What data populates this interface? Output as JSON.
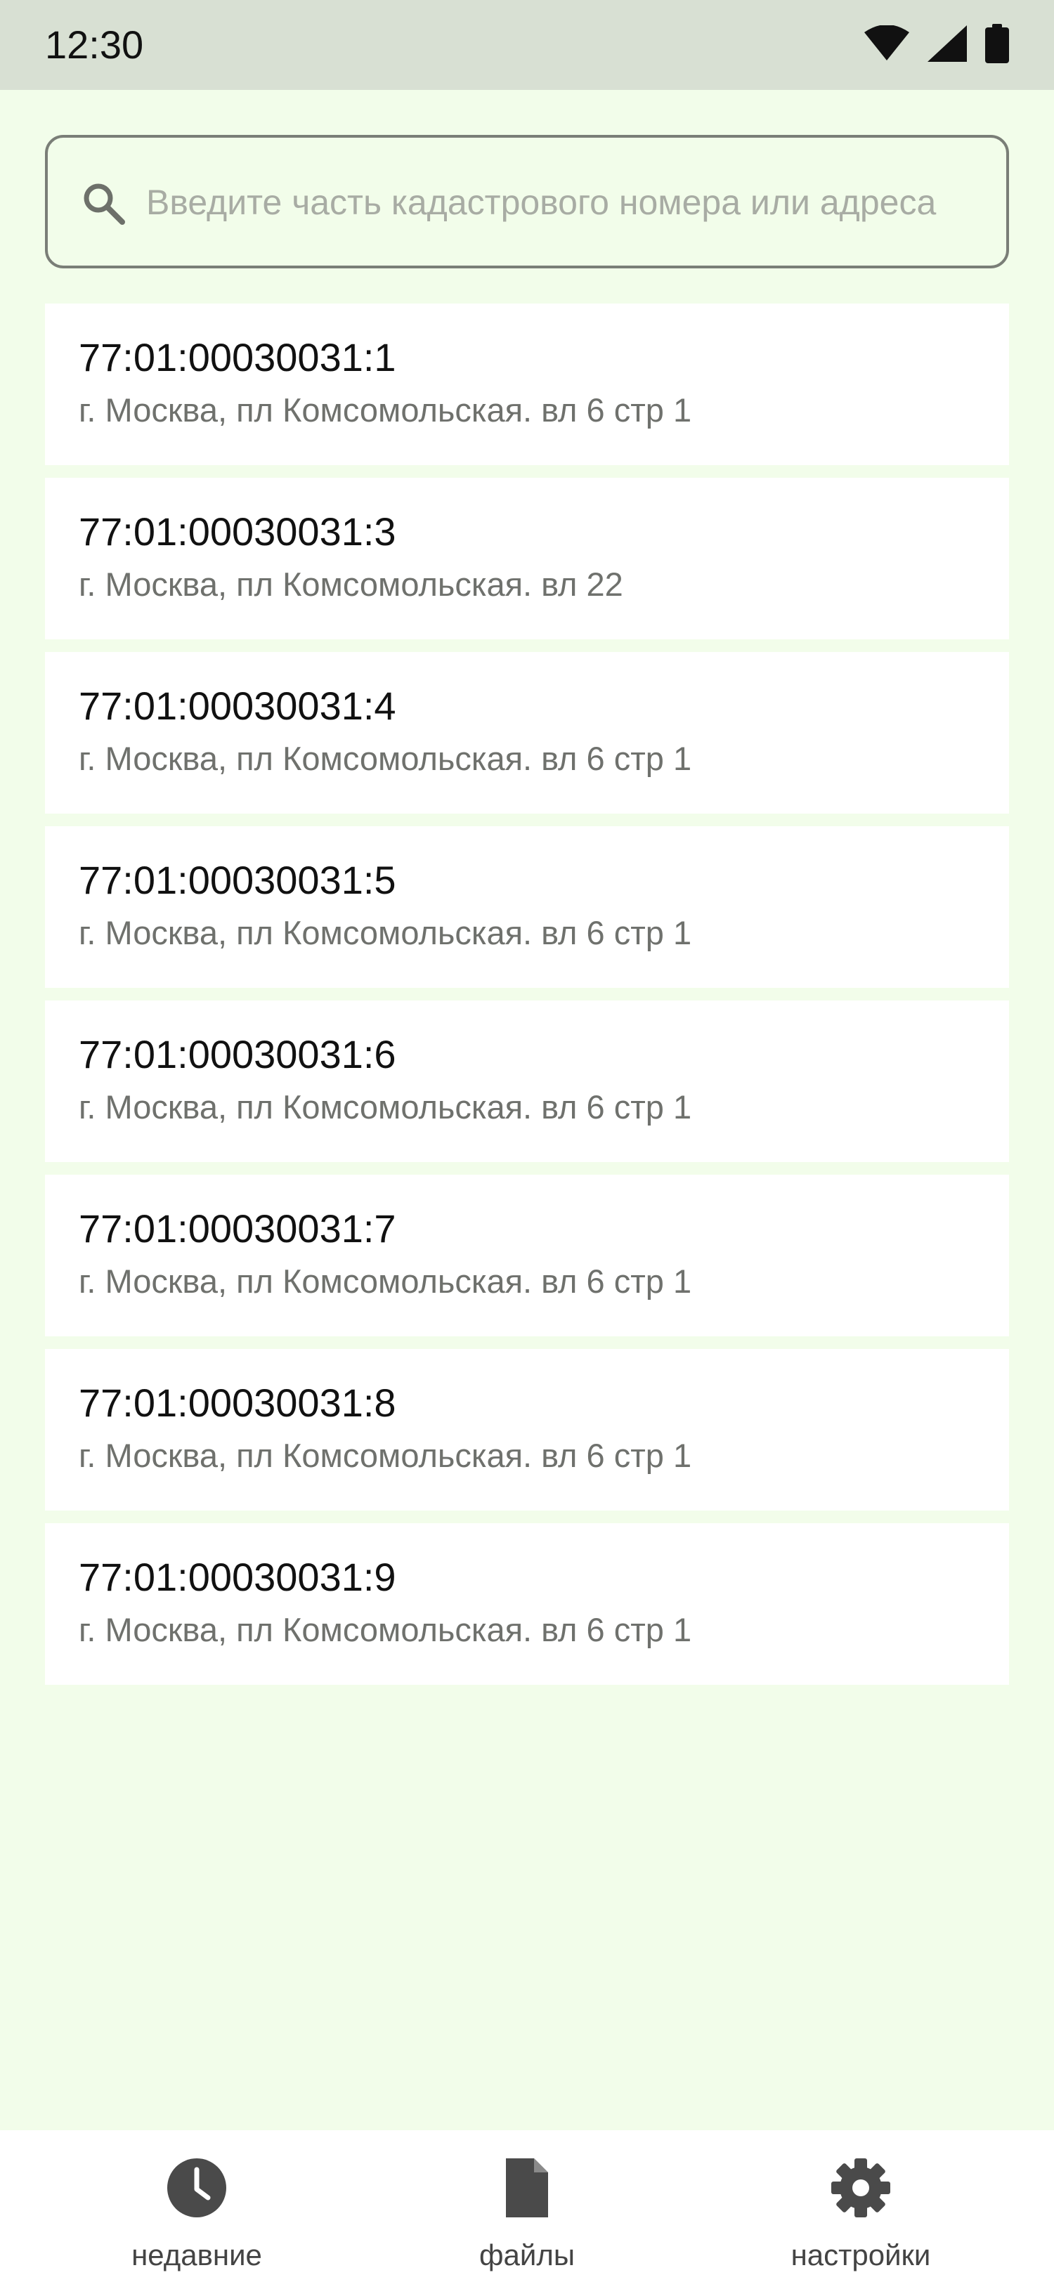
{
  "status_bar": {
    "time": "12:30",
    "icons": [
      "wifi-icon",
      "signal-icon",
      "battery-icon"
    ]
  },
  "search": {
    "placeholder": "Введите часть кадастрового номера или адреса",
    "value": ""
  },
  "results": [
    {
      "number": "77:01:00030031:1",
      "address": "г. Москва, пл Комсомольская. вл 6 стр 1"
    },
    {
      "number": "77:01:00030031:3",
      "address": "г. Москва, пл Комсомольская. вл 22"
    },
    {
      "number": "77:01:00030031:4",
      "address": "г. Москва, пл Комсомольская. вл 6 стр 1"
    },
    {
      "number": "77:01:00030031:5",
      "address": "г. Москва, пл Комсомольская. вл 6 стр 1"
    },
    {
      "number": "77:01:00030031:6",
      "address": "г. Москва, пл Комсомольская. вл 6 стр 1"
    },
    {
      "number": "77:01:00030031:7",
      "address": "г. Москва, пл Комсомольская. вл 6 стр 1"
    },
    {
      "number": "77:01:00030031:8",
      "address": "г. Москва, пл Комсомольская. вл 6 стр 1"
    },
    {
      "number": "77:01:00030031:9",
      "address": "г. Москва, пл Комсомольская. вл 6 стр 1"
    }
  ],
  "bottom_nav": [
    {
      "label": "недавние",
      "icon": "clock-icon"
    },
    {
      "label": "файлы",
      "icon": "file-icon"
    },
    {
      "label": "настройки",
      "icon": "gear-icon"
    }
  ],
  "colors": {
    "background": "#f2fdea",
    "status_bar": "#d8e0d3",
    "card": "#ffffff",
    "icon": "#4a4a4a"
  }
}
